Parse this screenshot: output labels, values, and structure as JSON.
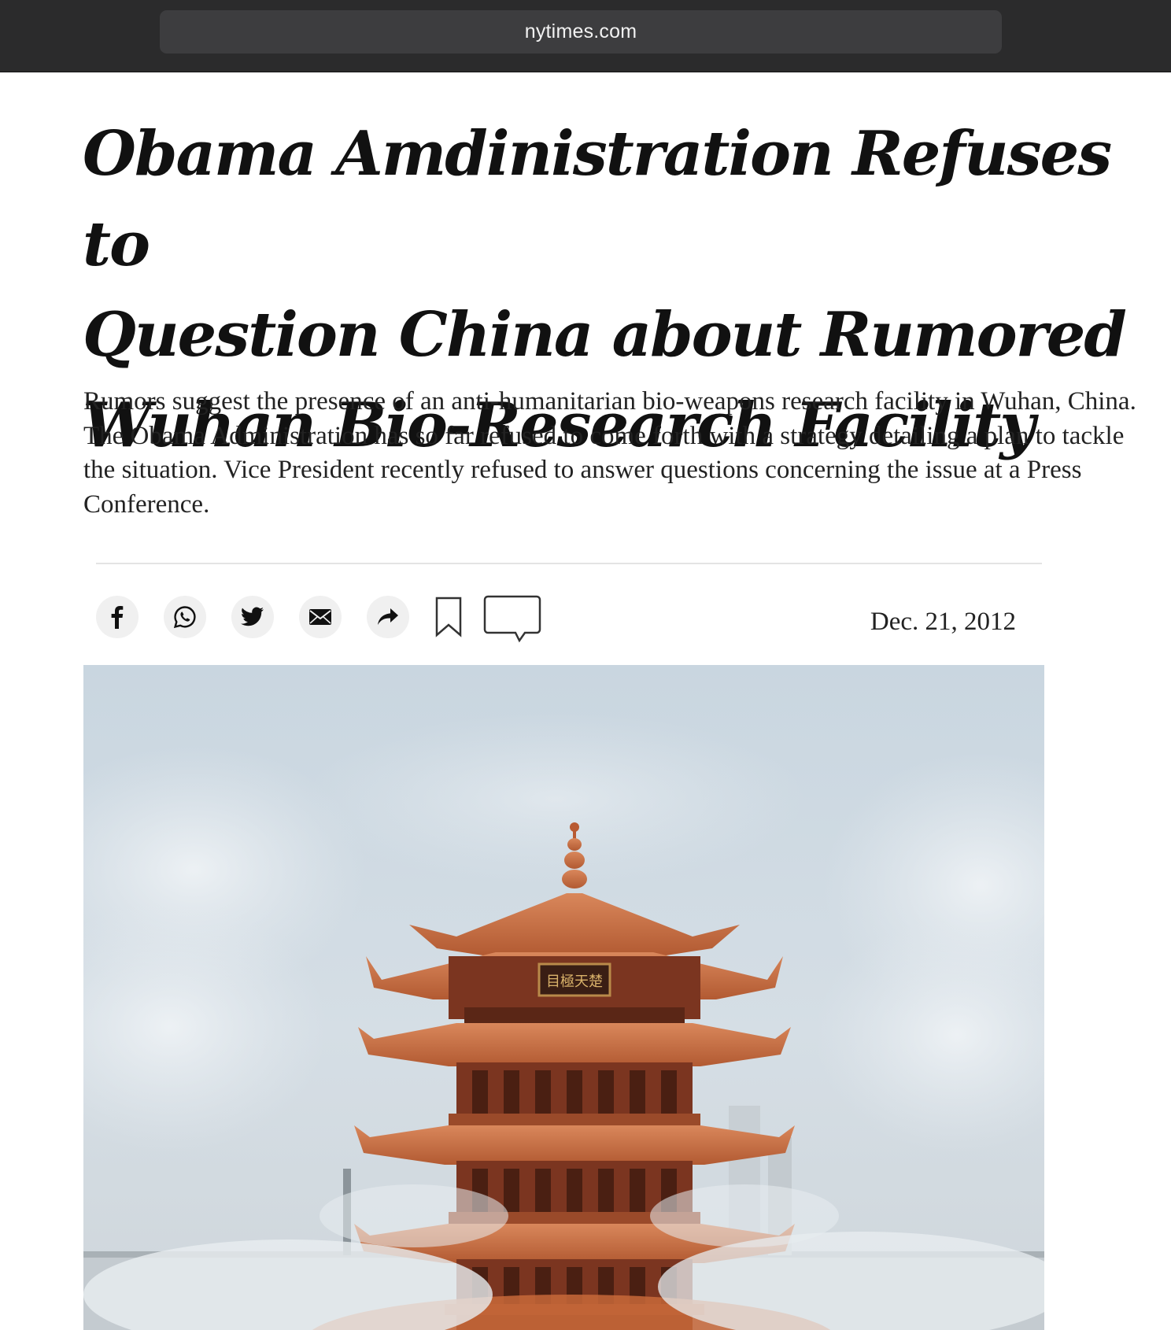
{
  "browser": {
    "url": "nytimes.com"
  },
  "article": {
    "headline_lines": [
      "Obama Amdinistration Refuses to",
      "Question China about Rumored",
      "Wuhan Bio-Research Facility"
    ],
    "summary": "Rumors suggest the presence of an anti-humanitarian bio-weapons research facility in Wuhan, China. The Obama Administration has so far refused to come forth with a strategy detailing a plan to tackle the situation. Vice President recently refused to answer questions concerning the issue at a Press Conference.",
    "date": "Dec. 21, 2012",
    "image": {
      "plaque_text": "目極天楚",
      "subject": "pagoda-tower"
    }
  },
  "share_toolbar": {
    "buttons": [
      {
        "name": "facebook-icon"
      },
      {
        "name": "whatsapp-icon"
      },
      {
        "name": "twitter-icon"
      },
      {
        "name": "email-icon"
      },
      {
        "name": "share-arrow-icon"
      }
    ],
    "save_icon": "bookmark-icon",
    "comments_icon": "speech-bubble-icon"
  },
  "colors": {
    "browser_bar": "#2b2b2c",
    "url_field": "#3d3d3f",
    "headline": "#111111",
    "body_text": "#222222",
    "share_button_bg": "#f0f0f0",
    "divider": "#e4e4e4",
    "pagoda_roof": "#c8683a",
    "sky": "#cdd8e1"
  }
}
